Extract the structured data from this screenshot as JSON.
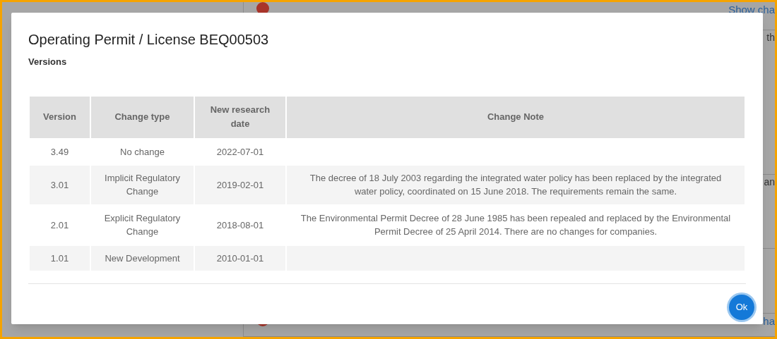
{
  "background": {
    "rows": [
      {
        "kind": "heading",
        "text": "Show cha"
      },
      {
        "kind": "text",
        "text": "th"
      },
      {
        "kind": "text",
        "text": "an"
      },
      {
        "kind": "empty"
      },
      {
        "kind": "heading",
        "text": "ha"
      }
    ]
  },
  "dialog": {
    "title": "Operating Permit / License BEQ00503",
    "subtitle": "Versions",
    "table": {
      "columns": [
        "Version",
        "Change type",
        "New research date",
        "Change Note"
      ],
      "rows": [
        {
          "version": "3.49",
          "change_type": "No change",
          "date": "2022-07-01",
          "note": ""
        },
        {
          "version": "3.01",
          "change_type": "Implicit Regulatory Change",
          "date": "2019-02-01",
          "note": "The decree of 18 July 2003 regarding the integrated water policy has been replaced by the integrated water policy, coordinated on 15 June 2018. The requirements remain the same."
        },
        {
          "version": "2.01",
          "change_type": "Explicit Regulatory Change",
          "date": "2018-08-01",
          "note": "The Environmental Permit Decree of 28 June 1985 has been repealed and replaced by the Environmental Permit Decree of 25 April 2014. There are no changes for companies."
        },
        {
          "version": "1.01",
          "change_type": "New Development",
          "date": "2010-01-01",
          "note": ""
        }
      ]
    },
    "button": "Ok"
  }
}
